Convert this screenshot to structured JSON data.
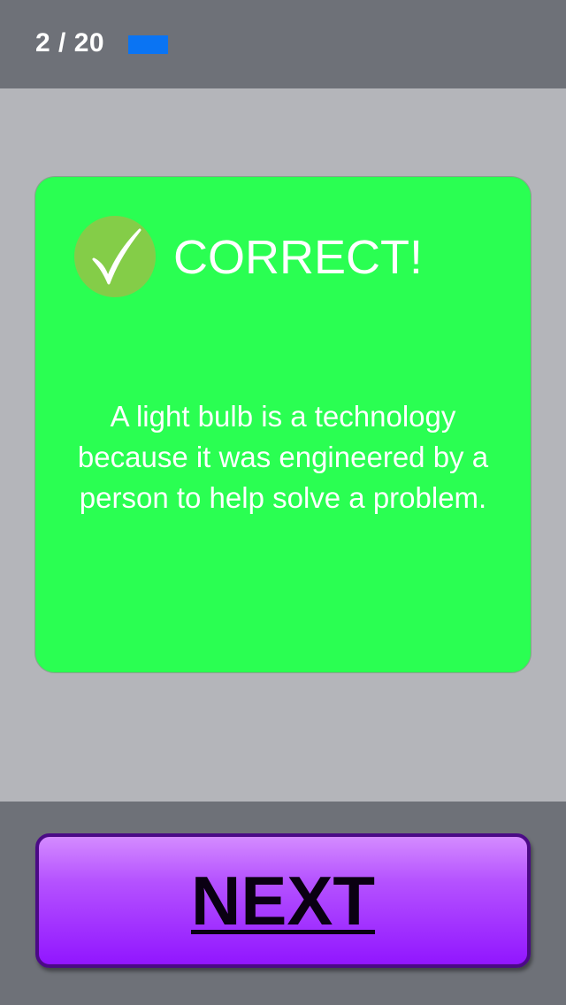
{
  "header": {
    "progress_label": "2 / 20",
    "progress_fraction": 0.1,
    "progress_color": "#0a74f3"
  },
  "feedback": {
    "icon": "checkmark-icon",
    "title": "CORRECT!",
    "message": "A light bulb is a technology because it was engineered by a person to help solve a problem.",
    "card_color": "#2aff52",
    "badge_color": "#84cd48"
  },
  "footer": {
    "next_label": "NEXT",
    "button_color": "#a030ff"
  }
}
